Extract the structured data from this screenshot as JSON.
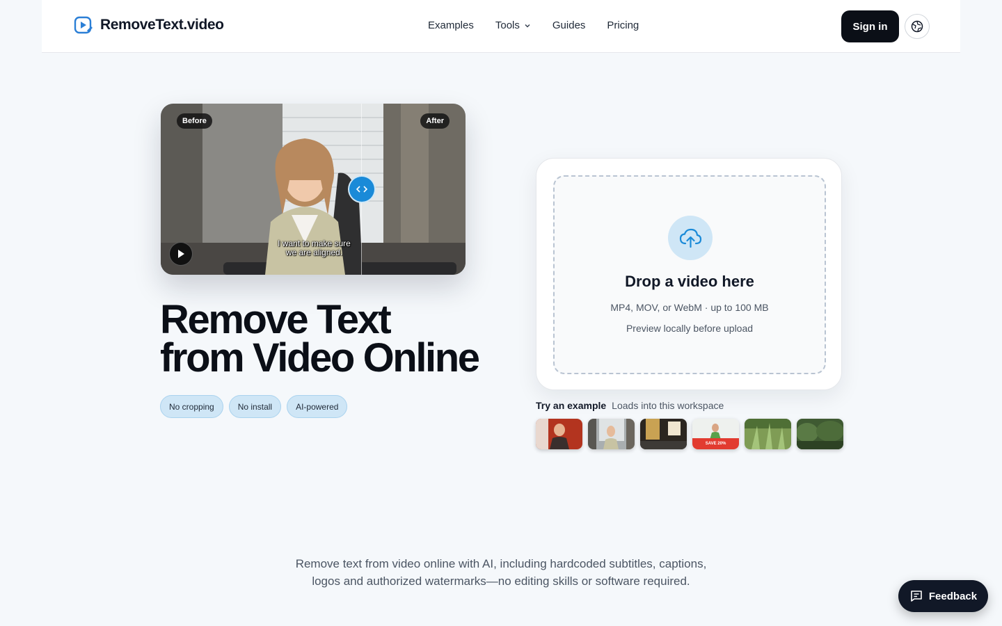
{
  "header": {
    "brand": "RemoveText.video",
    "nav": [
      {
        "label": "Examples"
      },
      {
        "label": "Tools"
      },
      {
        "label": "Guides"
      },
      {
        "label": "Pricing"
      }
    ],
    "sign_in": "Sign in"
  },
  "hero": {
    "before_label": "Before",
    "after_label": "After",
    "subtitle_line1": "I want to make sure",
    "subtitle_line2": "we are aligned.",
    "headline_line1": "Remove Text",
    "headline_line2": "from Video Online",
    "chips": [
      "No cropping",
      "No install",
      "AI-powered"
    ]
  },
  "upload": {
    "title": "Drop a video here",
    "formats": "MP4, MOV, or WebM · up to 100 MB",
    "note": "Preview locally before upload"
  },
  "examples": {
    "label": "Try an example",
    "note": "Loads into this workspace",
    "thumb_captions": [
      "SAVE 20%"
    ]
  },
  "description": {
    "line1": "Remove text from video online with AI, including hardcoded subtitles, captions,",
    "line2": "logos and authorized watermarks—no editing skills or software required."
  },
  "feedback": {
    "label": "Feedback"
  },
  "colors": {
    "accent": "#1a8ad8",
    "dark": "#0b0f17",
    "chip_bg": "#cfe6f6"
  }
}
